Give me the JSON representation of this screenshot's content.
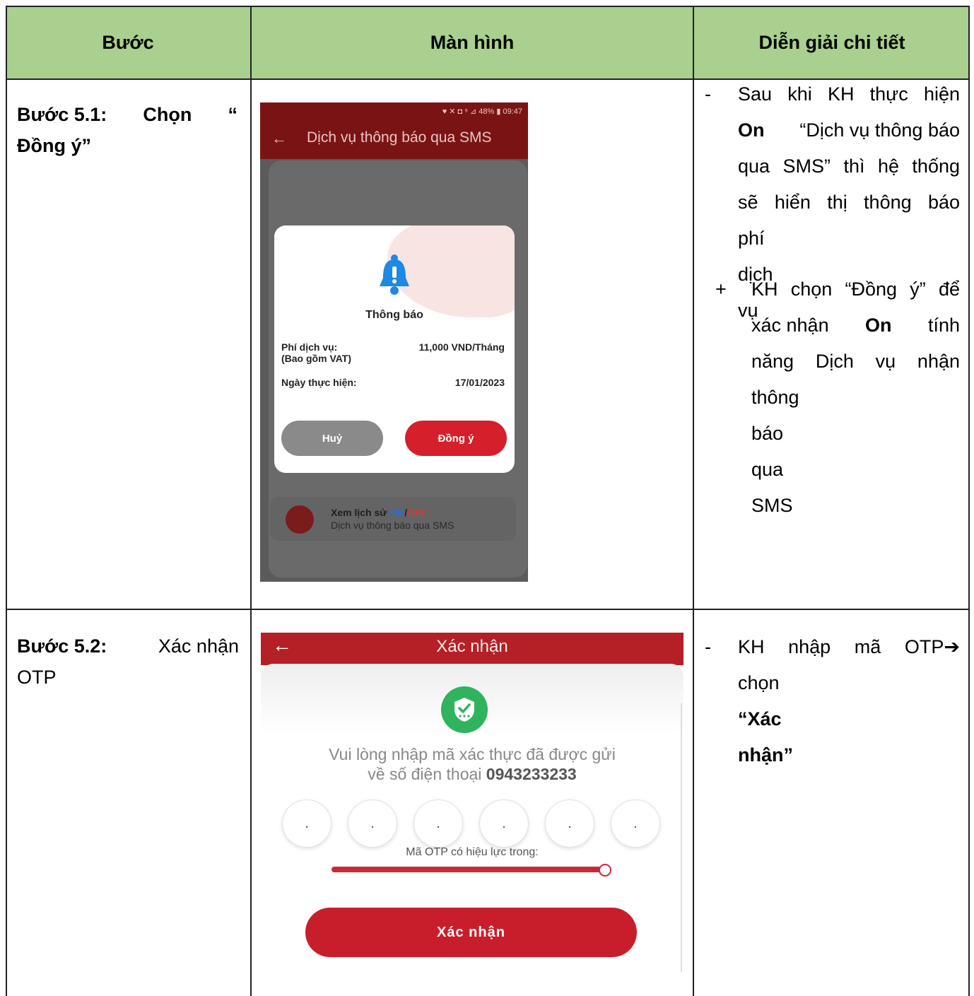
{
  "header": {
    "col1": "Bước",
    "col2": "Màn hình",
    "col3": "Diễn giải chi tiết"
  },
  "row1": {
    "step_label": "Bước 5.1:",
    "step_text_a": "Chọn",
    "step_text_b": "“",
    "step_text_c": "Đồng ý”",
    "desc": {
      "bullet_dash": "-",
      "line1": "Sau khi KH thực hiện",
      "line2_bold": "On",
      "line2_rest": "“Dịch vụ thông báo",
      "line3": "qua SMS” thì hệ thống",
      "line4": "sẽ hiển thị thông báo",
      "line5": "phí dịch vụ",
      "bullet_plus": "+",
      "sub1": "KH chọn “Đồng ý” để",
      "sub2_a": "xác nhận",
      "sub2_bold": "On",
      "sub2_b": "tính",
      "sub3": "năng Dịch vụ nhận",
      "sub4": "thông báo qua SMS"
    },
    "phone": {
      "status": "♥ ✕ ◘ ⁹ ⊿ 48% ▮ 09:47",
      "back_icon": "←",
      "title": "Dịch vụ thông báo qua SMS",
      "dialog_title": "Thông báo",
      "fee_label": "Phí dịch vụ:",
      "fee_sub": "(Bao gồm VAT)",
      "fee_value": "11,000 VND/Tháng",
      "date_label": "Ngày thực hiện:",
      "date_value": "17/01/2023",
      "cancel": "Huỷ",
      "confirm": "Đồng ý",
      "history_prefix": "Xem lịch sử ",
      "history_on": "ON",
      "history_sep": "/",
      "history_off": "OFF",
      "history_sub": "Dịch vụ thông báo qua SMS"
    }
  },
  "row2": {
    "step_label": "Bước 5.2:",
    "step_text_a": "Xác nhận",
    "step_text_b": "OTP",
    "desc": {
      "bullet_dash": "-",
      "line1": "KH nhập mã OTP➔",
      "line2_a": "chọn ",
      "line2_bold": "“Xác nhận”"
    },
    "phone": {
      "back_icon": "←",
      "title": "Xác nhận",
      "msg1": "Vui lòng nhập mã xác thực đã được gửi",
      "msg2_a": "về số điện thoại ",
      "msg2_phone": "0943233233",
      "otp_placeholder": ".",
      "valid_text": "Mã OTP có hiệu lực trong:",
      "button": "Xác nhận"
    }
  },
  "colors": {
    "header_bg": "#a9d08e",
    "brand_red": "#c81e2b",
    "dark_red": "#7a1414",
    "shield_green": "#2fb35c",
    "bell_blue": "#1e88e5"
  }
}
